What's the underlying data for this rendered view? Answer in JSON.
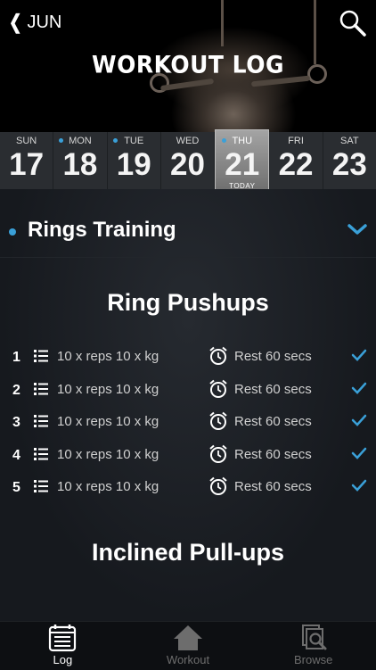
{
  "header": {
    "back_label": "JUN",
    "title": "WORKOUT LOG"
  },
  "week": {
    "days": [
      {
        "name": "SUN",
        "num": "17",
        "dot": false,
        "today": false
      },
      {
        "name": "MON",
        "num": "18",
        "dot": true,
        "today": false
      },
      {
        "name": "TUE",
        "num": "19",
        "dot": true,
        "today": false
      },
      {
        "name": "WED",
        "num": "20",
        "dot": false,
        "today": false
      },
      {
        "name": "THU",
        "num": "21",
        "dot": true,
        "today": true
      },
      {
        "name": "FRI",
        "num": "22",
        "dot": false,
        "today": false
      },
      {
        "name": "SAT",
        "num": "23",
        "dot": false,
        "today": false
      }
    ],
    "today_label": "TODAY"
  },
  "section": {
    "name": "Rings Training"
  },
  "exercises": [
    {
      "title": "Ring Pushups",
      "sets": [
        {
          "num": "1",
          "detail": "10 x reps 10 x kg",
          "rest": "Rest  60 secs"
        },
        {
          "num": "2",
          "detail": "10 x reps 10 x kg",
          "rest": "Rest  60 secs"
        },
        {
          "num": "3",
          "detail": "10 x reps 10 x kg",
          "rest": "Rest  60 secs"
        },
        {
          "num": "4",
          "detail": "10 x reps 10 x kg",
          "rest": "Rest  60 secs"
        },
        {
          "num": "5",
          "detail": "10 x reps 10 x kg",
          "rest": "Rest  60 secs"
        }
      ]
    },
    {
      "title": "Inclined Pull-ups",
      "sets": []
    }
  ],
  "tabs": [
    {
      "label": "Log",
      "icon": "log-icon",
      "active": true
    },
    {
      "label": "Workout",
      "icon": "home-icon",
      "active": false
    },
    {
      "label": "Browse",
      "icon": "browse-icon",
      "active": false
    }
  ],
  "colors": {
    "accent": "#3aa0d8",
    "background": "#16191e"
  }
}
